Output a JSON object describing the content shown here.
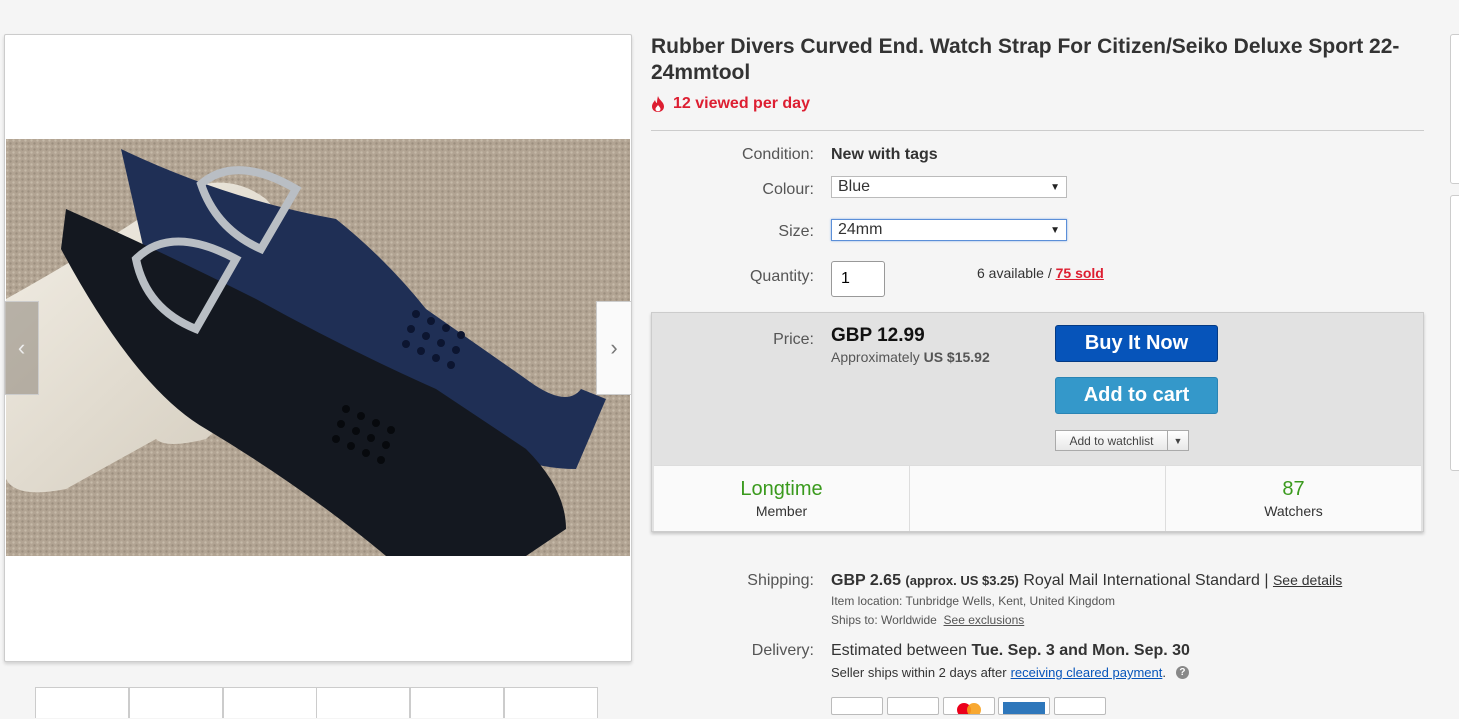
{
  "title": "Rubber Divers Curved End. Watch Strap For Citizen/Seiko Deluxe Sport 22-24mmtool",
  "views": {
    "icon": "fire-icon",
    "text": "12 viewed per day"
  },
  "condition": {
    "label": "Condition:",
    "value": "New with tags"
  },
  "colour": {
    "label": "Colour:",
    "value": "Blue"
  },
  "size": {
    "label": "Size:",
    "value": "24mm"
  },
  "quantity": {
    "label": "Quantity:",
    "value": "1",
    "available": "6 available / ",
    "sold": "75 sold"
  },
  "price": {
    "label": "Price:",
    "value": "GBP 12.99",
    "approx_prefix": "Approximately",
    "approx_value": "US $15.92"
  },
  "buttons": {
    "buy_now": "Buy It Now",
    "add_to_cart": "Add to cart",
    "watchlist": "Add to watchlist"
  },
  "stats": [
    {
      "big": "Longtime",
      "small": "Member"
    },
    {
      "big": "",
      "small": ""
    },
    {
      "big": "87",
      "small": "Watchers"
    }
  ],
  "shipping": {
    "label": "Shipping:",
    "cost": "GBP 2.65",
    "approx": "(approx. US $3.25)",
    "service": "Royal Mail International Standard",
    "separator": "|",
    "details_link": "See details",
    "location_label": "Item location:",
    "location": "Tunbridge Wells, Kent, United Kingdom",
    "ships_to_label": "Ships to:",
    "ships_to": "Worldwide",
    "exclusions_link": "See exclusions"
  },
  "delivery": {
    "label": "Delivery:",
    "prefix": "Estimated between",
    "dates": "Tue. Sep. 3 and Mon. Sep. 30",
    "note_prefix": "Seller ships within 2 days after",
    "note_link": "receiving cleared payment",
    "note_suffix": "."
  },
  "colors": {
    "accent_red": "#dd1e31",
    "buy_blue": "#0654ba",
    "cart_blue": "#3498ca",
    "green": "#3a9a1d"
  }
}
